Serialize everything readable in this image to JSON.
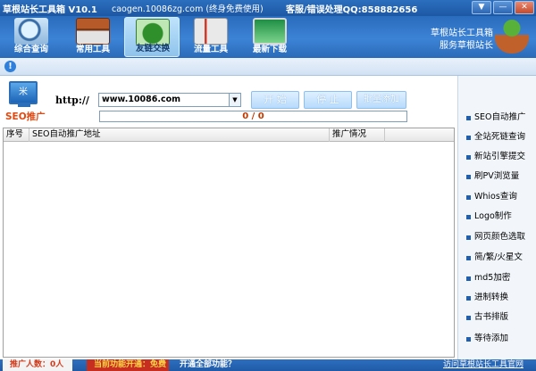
{
  "titlebar": {
    "app_title": "草根站长工具箱 V10.1",
    "site": "caogen.10086zg.com (终身免费使用)",
    "support": "客服/错误处理QQ:858882656"
  },
  "toolbar": {
    "items": [
      {
        "label": "综合查询",
        "icon": "magnifier-icon"
      },
      {
        "label": "常用工具",
        "icon": "toolbox-icon"
      },
      {
        "label": "友链交换",
        "icon": "clover-links-icon"
      },
      {
        "label": "流量工具",
        "icon": "thermometer-chart-icon"
      },
      {
        "label": "最新下载",
        "icon": "monitor-download-icon"
      }
    ],
    "brand_line1": "草根站长工具箱",
    "brand_line2": "服务草根站长"
  },
  "main": {
    "seo_logo_text": "米",
    "seo_label": "SEO推广",
    "http_label": "http://",
    "url_value": "www.10086.com",
    "start_button": "开 始",
    "stop_button": "停 止",
    "batch_add_button": "批量添加",
    "progress_text": "0 / 0",
    "progress_fraction": 0,
    "columns": [
      "序号",
      "SEO自动推广地址",
      "推广情况"
    ]
  },
  "sidebar": {
    "items": [
      "SEO自动推广",
      "全站死链查询",
      "新站引擎提交",
      "刷PV浏览量",
      "Whios查询",
      "Logo制作",
      "网页颜色选取",
      "简/繁/火星文",
      "md5加密",
      "进制转换",
      "古书排版",
      "等待添加"
    ]
  },
  "statusbar": {
    "users": "推广人数：0人",
    "mode": "当前功能开通：免费",
    "open_all": "开通全部功能？",
    "visit_site": "访问草根站长工具官网"
  },
  "colors": {
    "titlebar": "#1d57a4",
    "toolbar": "#3c83d6",
    "accent_orange": "#e04a12",
    "statusbar": "#1f5aa6"
  }
}
